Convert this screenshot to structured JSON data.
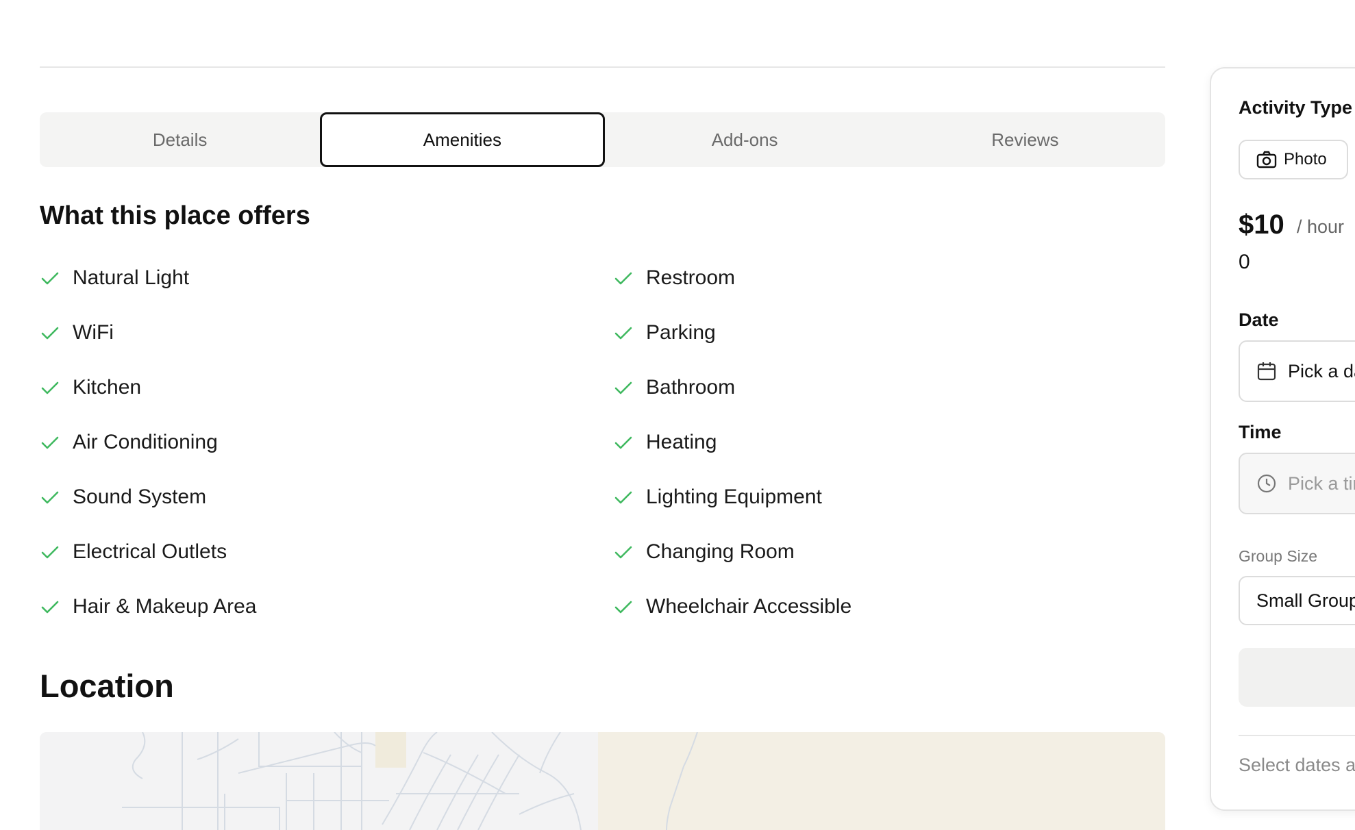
{
  "tabs": [
    {
      "label": "Details",
      "active": false
    },
    {
      "label": "Amenities",
      "active": true
    },
    {
      "label": "Add-ons",
      "active": false
    },
    {
      "label": "Reviews",
      "active": false
    }
  ],
  "amenities_section": {
    "title": "What this place offers",
    "left_column": [
      "Natural Light",
      "WiFi",
      "Kitchen",
      "Air Conditioning",
      "Sound System",
      "Electrical Outlets",
      "Hair & Makeup Area"
    ],
    "right_column": [
      "Restroom",
      "Parking",
      "Bathroom",
      "Heating",
      "Lighting Equipment",
      "Changing Room",
      "Wheelchair Accessible"
    ],
    "check_color": "#3fb95f"
  },
  "location": {
    "title": "Location"
  },
  "booking": {
    "activity_label": "Activity Type",
    "activity_button": "Photo",
    "price": "$10",
    "price_unit": "/ hour",
    "price_sub": "0",
    "date_label": "Date",
    "date_placeholder": "Pick a date",
    "time_label": "Time",
    "time_placeholder": "Pick a time",
    "group_label": "Group Size",
    "group_value": "Small Group",
    "footer_note": "Select dates and time"
  }
}
